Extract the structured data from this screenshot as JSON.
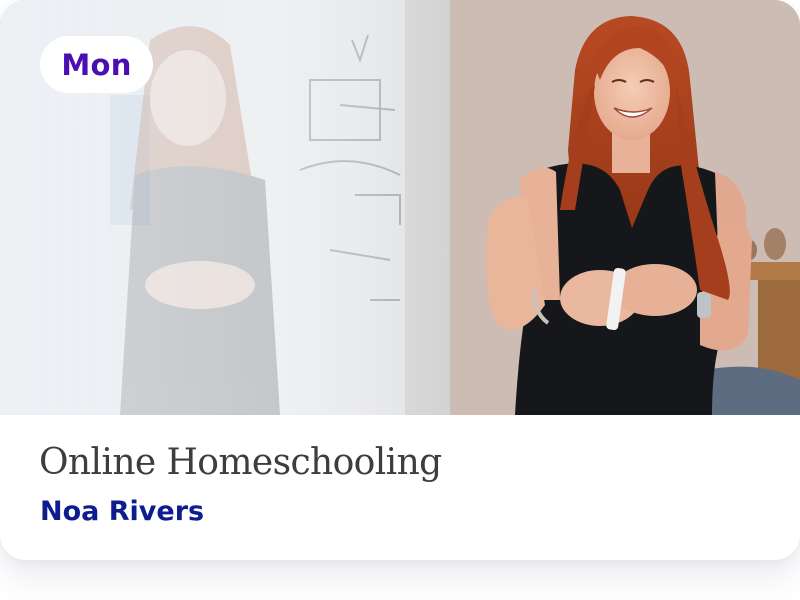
{
  "card": {
    "day_label": "Mon",
    "title": "Online Homeschooling",
    "instructor": "Noa Rivers",
    "photo_alt": "photo-of-woman-at-whiteboard"
  },
  "colors": {
    "badge_bg": "#ffffff",
    "badge_text": "#4a0fb2",
    "title_text": "#3d3d3d",
    "instructor_text": "#0d1c8f",
    "card_bg": "#ffffff"
  }
}
